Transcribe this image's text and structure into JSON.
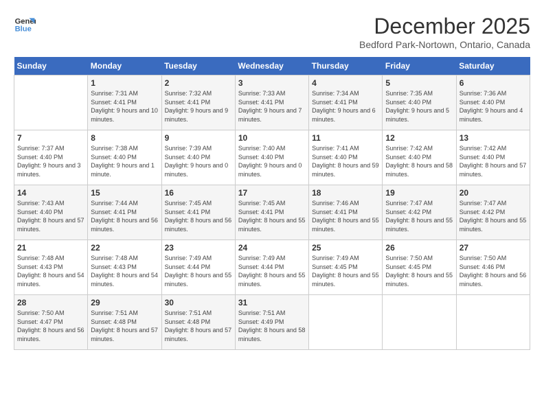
{
  "logo": {
    "line1": "General",
    "line2": "Blue"
  },
  "header": {
    "month": "December 2025",
    "location": "Bedford Park-Nortown, Ontario, Canada"
  },
  "weekdays": [
    "Sunday",
    "Monday",
    "Tuesday",
    "Wednesday",
    "Thursday",
    "Friday",
    "Saturday"
  ],
  "weeks": [
    [
      {
        "day": "",
        "empty": true
      },
      {
        "day": "1",
        "sunrise": "7:31 AM",
        "sunset": "4:41 PM",
        "daylight": "9 hours and 10 minutes."
      },
      {
        "day": "2",
        "sunrise": "7:32 AM",
        "sunset": "4:41 PM",
        "daylight": "9 hours and 9 minutes."
      },
      {
        "day": "3",
        "sunrise": "7:33 AM",
        "sunset": "4:41 PM",
        "daylight": "9 hours and 7 minutes."
      },
      {
        "day": "4",
        "sunrise": "7:34 AM",
        "sunset": "4:41 PM",
        "daylight": "9 hours and 6 minutes."
      },
      {
        "day": "5",
        "sunrise": "7:35 AM",
        "sunset": "4:40 PM",
        "daylight": "9 hours and 5 minutes."
      },
      {
        "day": "6",
        "sunrise": "7:36 AM",
        "sunset": "4:40 PM",
        "daylight": "9 hours and 4 minutes."
      }
    ],
    [
      {
        "day": "7",
        "sunrise": "7:37 AM",
        "sunset": "4:40 PM",
        "daylight": "9 hours and 3 minutes."
      },
      {
        "day": "8",
        "sunrise": "7:38 AM",
        "sunset": "4:40 PM",
        "daylight": "9 hours and 1 minute."
      },
      {
        "day": "9",
        "sunrise": "7:39 AM",
        "sunset": "4:40 PM",
        "daylight": "9 hours and 0 minutes."
      },
      {
        "day": "10",
        "sunrise": "7:40 AM",
        "sunset": "4:40 PM",
        "daylight": "9 hours and 0 minutes."
      },
      {
        "day": "11",
        "sunrise": "7:41 AM",
        "sunset": "4:40 PM",
        "daylight": "8 hours and 59 minutes."
      },
      {
        "day": "12",
        "sunrise": "7:42 AM",
        "sunset": "4:40 PM",
        "daylight": "8 hours and 58 minutes."
      },
      {
        "day": "13",
        "sunrise": "7:42 AM",
        "sunset": "4:40 PM",
        "daylight": "8 hours and 57 minutes."
      }
    ],
    [
      {
        "day": "14",
        "sunrise": "7:43 AM",
        "sunset": "4:40 PM",
        "daylight": "8 hours and 57 minutes."
      },
      {
        "day": "15",
        "sunrise": "7:44 AM",
        "sunset": "4:41 PM",
        "daylight": "8 hours and 56 minutes."
      },
      {
        "day": "16",
        "sunrise": "7:45 AM",
        "sunset": "4:41 PM",
        "daylight": "8 hours and 56 minutes."
      },
      {
        "day": "17",
        "sunrise": "7:45 AM",
        "sunset": "4:41 PM",
        "daylight": "8 hours and 55 minutes."
      },
      {
        "day": "18",
        "sunrise": "7:46 AM",
        "sunset": "4:41 PM",
        "daylight": "8 hours and 55 minutes."
      },
      {
        "day": "19",
        "sunrise": "7:47 AM",
        "sunset": "4:42 PM",
        "daylight": "8 hours and 55 minutes."
      },
      {
        "day": "20",
        "sunrise": "7:47 AM",
        "sunset": "4:42 PM",
        "daylight": "8 hours and 55 minutes."
      }
    ],
    [
      {
        "day": "21",
        "sunrise": "7:48 AM",
        "sunset": "4:43 PM",
        "daylight": "8 hours and 54 minutes."
      },
      {
        "day": "22",
        "sunrise": "7:48 AM",
        "sunset": "4:43 PM",
        "daylight": "8 hours and 54 minutes."
      },
      {
        "day": "23",
        "sunrise": "7:49 AM",
        "sunset": "4:44 PM",
        "daylight": "8 hours and 55 minutes."
      },
      {
        "day": "24",
        "sunrise": "7:49 AM",
        "sunset": "4:44 PM",
        "daylight": "8 hours and 55 minutes."
      },
      {
        "day": "25",
        "sunrise": "7:49 AM",
        "sunset": "4:45 PM",
        "daylight": "8 hours and 55 minutes."
      },
      {
        "day": "26",
        "sunrise": "7:50 AM",
        "sunset": "4:45 PM",
        "daylight": "8 hours and 55 minutes."
      },
      {
        "day": "27",
        "sunrise": "7:50 AM",
        "sunset": "4:46 PM",
        "daylight": "8 hours and 56 minutes."
      }
    ],
    [
      {
        "day": "28",
        "sunrise": "7:50 AM",
        "sunset": "4:47 PM",
        "daylight": "8 hours and 56 minutes."
      },
      {
        "day": "29",
        "sunrise": "7:51 AM",
        "sunset": "4:48 PM",
        "daylight": "8 hours and 57 minutes."
      },
      {
        "day": "30",
        "sunrise": "7:51 AM",
        "sunset": "4:48 PM",
        "daylight": "8 hours and 57 minutes."
      },
      {
        "day": "31",
        "sunrise": "7:51 AM",
        "sunset": "4:49 PM",
        "daylight": "8 hours and 58 minutes."
      },
      {
        "day": "",
        "empty": true
      },
      {
        "day": "",
        "empty": true
      },
      {
        "day": "",
        "empty": true
      }
    ]
  ],
  "labels": {
    "sunrise_prefix": "Sunrise: ",
    "sunset_prefix": "Sunset: ",
    "daylight_prefix": "Daylight: "
  }
}
